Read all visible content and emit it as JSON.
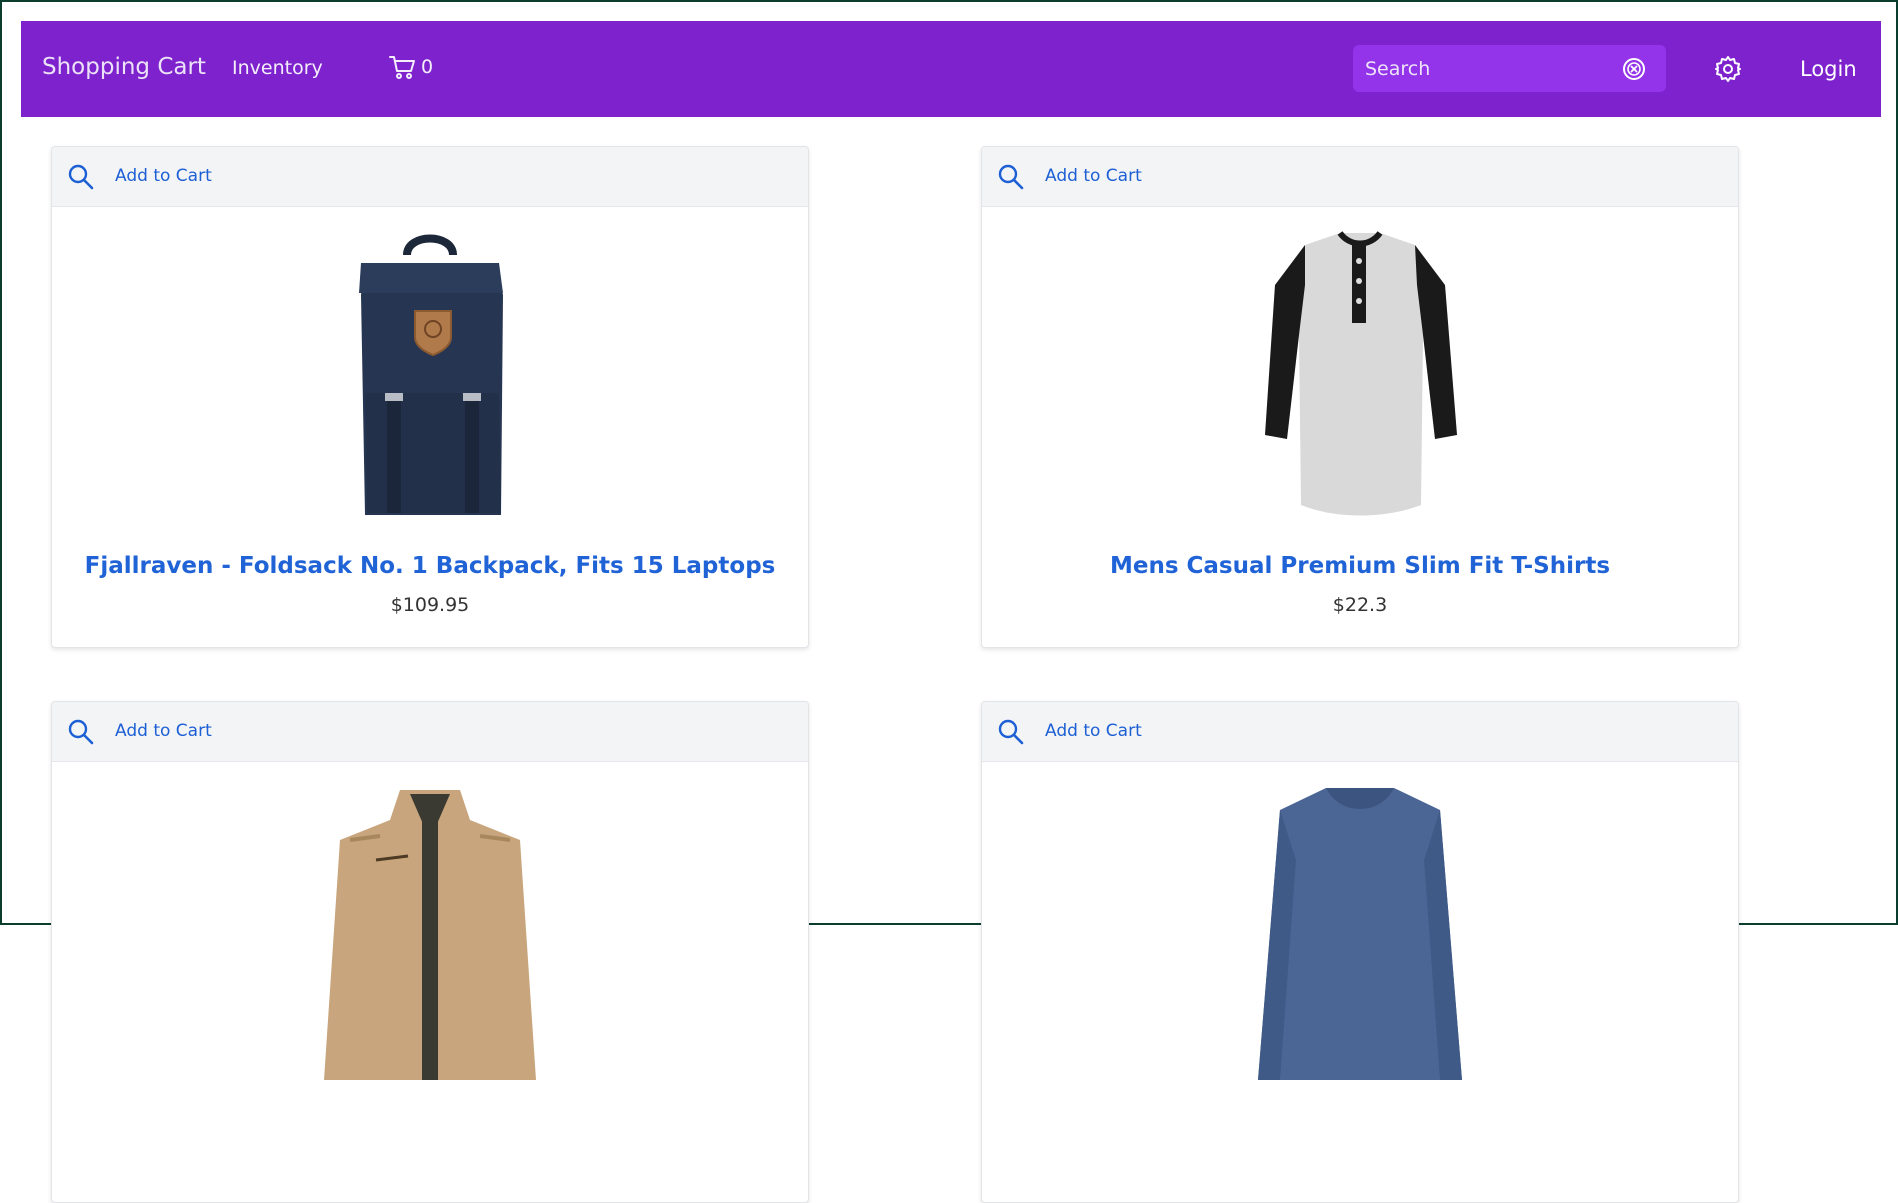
{
  "navbar": {
    "brand": "Shopping Cart",
    "inventory_link": "Inventory",
    "cart_count": "0",
    "search_placeholder": "Search",
    "login": "Login",
    "background": "#7e22ce",
    "search_background": "#9333ea"
  },
  "icons": {
    "cart": "cart-icon",
    "clear": "clear-search-icon",
    "settings": "gear-icon",
    "zoom": "search-icon"
  },
  "products": [
    {
      "add_label": "Add to Cart",
      "title": "Fjallraven - Foldsack No. 1 Backpack, Fits 15 Laptops",
      "price": "$109.95",
      "image": "backpack"
    },
    {
      "add_label": "Add to Cart",
      "title": "Mens Casual Premium Slim Fit T-Shirts",
      "price": "$22.3",
      "image": "henley-t-shirt"
    },
    {
      "add_label": "Add to Cart",
      "title": "",
      "price": "",
      "image": "cotton-jacket"
    },
    {
      "add_label": "Add to Cart",
      "title": "",
      "price": "",
      "image": "slim-fit-long-sleeve"
    }
  ],
  "colors": {
    "link": "#1f63d6",
    "card_header": "#f3f4f6"
  }
}
